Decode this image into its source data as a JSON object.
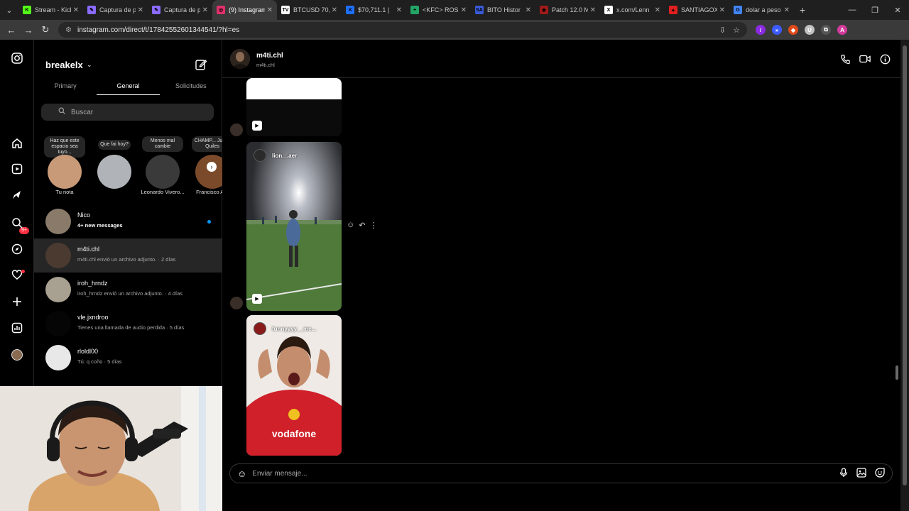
{
  "browser": {
    "tabs": [
      {
        "label": "Stream - Kick",
        "color": "#53fc18",
        "glyph": "K"
      },
      {
        "label": "Captura de p",
        "color": "#8a6cff",
        "glyph": "✎"
      },
      {
        "label": "Captura de p",
        "color": "#8a6cff",
        "glyph": "✎"
      },
      {
        "label": "(9) Instagram",
        "color": "#e1306c",
        "glyph": "◎",
        "active": true
      },
      {
        "label": "BTCUSD 70,",
        "color": "#ffffff",
        "glyph": "TV"
      },
      {
        "label": "$70,711.1 |",
        "color": "#1f6fff",
        "glyph": "✕"
      },
      {
        "label": "<KFC> ROS",
        "color": "#23a566",
        "glyph": "+"
      },
      {
        "label": "BITO Histor",
        "color": "#3a5bd9",
        "glyph": "SA"
      },
      {
        "label": "Patch 12.0 M",
        "color": "#a01a1a",
        "glyph": "◆"
      },
      {
        "label": "x.com/Lenn",
        "color": "#ffffff",
        "glyph": "X"
      },
      {
        "label": "SANTIAGOX",
        "color": "#e02020",
        "glyph": "▲"
      },
      {
        "label": "dolar a peso",
        "color": "#4285f4",
        "glyph": "G"
      }
    ],
    "url": "instagram.com/direct/t/17842552601344541/?hl=es",
    "extensions": [
      {
        "color": "#8a2be2",
        "glyph": "/"
      },
      {
        "color": "#3b5bff",
        "glyph": "»"
      },
      {
        "color": "#e04a1a",
        "glyph": "◆"
      },
      {
        "color": "#ffffff",
        "glyph": "U"
      },
      {
        "color": "#555555",
        "glyph": "⧉"
      },
      {
        "color": "#d13b9c",
        "glyph": "A"
      }
    ]
  },
  "inbox": {
    "account": "breakelx",
    "tabs": [
      {
        "label": "Primary"
      },
      {
        "label": "General",
        "active": true
      },
      {
        "label": "Solicitudes"
      }
    ],
    "search_placeholder": "Buscar",
    "notes": [
      {
        "bubble": "Haz que este espacio sea tuyo...",
        "name": "Tu nota",
        "avatar_color": "#c89a78"
      },
      {
        "bubble": "Que fai hoy?",
        "name": "",
        "avatar_color": "#b0b4b8"
      },
      {
        "bubble": "Menos mal cambie",
        "name": "Leonardo Vivero...",
        "avatar_color": "#3a3a3a"
      },
      {
        "bubble": "CHAMP... Justin Quiles",
        "name": "Francisco Are",
        "avatar_color": "#7a4a2a"
      }
    ],
    "conversations": [
      {
        "name": "Nico",
        "preview": "4+ new messages",
        "unread": true,
        "avatar_color": "#8a7a6a"
      },
      {
        "name": "m4ti.chl",
        "preview": "m4ti.chl envió un archivo adjunto. · 2 días",
        "selected": true,
        "avatar_color": "#4a3a30"
      },
      {
        "name": "iroh_hrndz",
        "preview": "iroh_hrndz envió un archivo adjunto. · 4 días",
        "avatar_color": "#a8a090"
      },
      {
        "name": "vle.jxndroo",
        "preview": "Tienes una llamada de audio perdida · 5 días",
        "avatar_color": "#050505"
      },
      {
        "name": "rloldl00",
        "preview": "Tú: q coño · 5 días",
        "avatar_color": "#e8e8e8"
      }
    ]
  },
  "chat": {
    "name": "m4ti.chl",
    "username": "m4ti.chl",
    "cards": [
      {
        "user": "",
        "kind": "reel"
      },
      {
        "user": "lion._.aer",
        "kind": "reel"
      },
      {
        "user": "funnyyyy__me...",
        "kind": "post"
      }
    ],
    "composer_placeholder": "Enviar mensaje..."
  }
}
